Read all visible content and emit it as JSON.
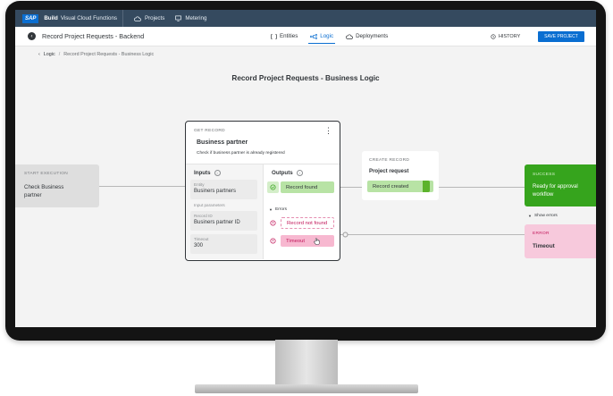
{
  "topbar": {
    "logo": "SAP",
    "brand_bold": "Build",
    "brand_rest": "Visual Cloud Functions",
    "items": [
      {
        "label": "Projects",
        "icon": "cloud-icon"
      },
      {
        "label": "Metering",
        "icon": "monitor-icon"
      }
    ]
  },
  "header": {
    "title": "Record Project Requests - Backend",
    "tabs": [
      {
        "label": "Entities",
        "icon": "brackets-icon",
        "active": false
      },
      {
        "label": "Logic",
        "icon": "flow-icon",
        "active": true
      },
      {
        "label": "Deployments",
        "icon": "cloud-upload-icon",
        "active": false
      }
    ],
    "history_label": "HISTORY",
    "save_label": "SAVE PROJECT"
  },
  "breadcrumb": {
    "parent": "Logic",
    "current": "Record Project Requests - Business Logic"
  },
  "canvas": {
    "title": "Record Project Requests - Business Logic",
    "start": {
      "caption": "START EXECUTION",
      "text": "Check Business partner"
    },
    "get_record": {
      "caption": "GET RECORD",
      "title": "Business partner",
      "description": "Check if business partner is already registered",
      "inputs_label": "Inputs",
      "outputs_label": "Outputs",
      "entity": {
        "label": "Entity",
        "value": "Businers partners"
      },
      "input_params_label": "Input parameters",
      "record_id": {
        "label": "Record ID",
        "value": "Businers partner ID"
      },
      "timeout": {
        "label": "Timeout",
        "value": "300"
      },
      "output_found": "Record found",
      "errors_label": "Errors",
      "error_not_found": "Record not found",
      "error_timeout": "Timeout"
    },
    "create_record": {
      "caption": "CREATE RECORD",
      "title": "Project request",
      "output": "Record created"
    },
    "success": {
      "caption": "SUCCESS",
      "text": "Ready for approval workflow"
    },
    "show_errors_label": "Show errors",
    "error": {
      "caption": "ERROR",
      "text": "Timeout"
    }
  },
  "colors": {
    "shell": "#354a5f",
    "accent": "#0a6ed1",
    "success": "#36a41d",
    "success_light": "#b8e3a5",
    "error_light": "#f7c9dc",
    "error": "#c2185b"
  }
}
